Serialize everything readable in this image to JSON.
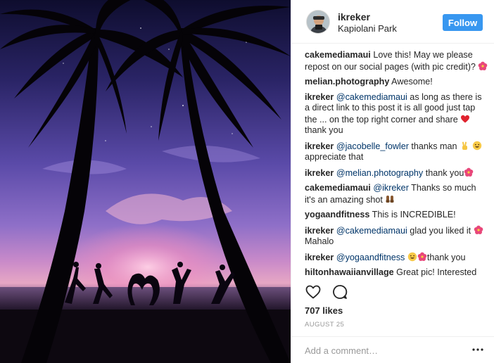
{
  "post": {
    "username": "ikreker",
    "location": "Kapiolani Park",
    "follow_label": "Follow",
    "likes": "707 likes",
    "date": "AUGUST 25",
    "add_comment_placeholder": "Add a comment…"
  },
  "colors": {
    "follow_button": "#3897f0",
    "mention": "#003569",
    "muted": "#999999"
  },
  "icons": {
    "like": "heart-outline-icon",
    "comment": "speech-bubble-icon",
    "more": "ellipsis-icon"
  },
  "comments": [
    {
      "user": "cakemediamaui",
      "parts": [
        {
          "t": "text",
          "v": "Love this! May we please repost on our social pages (with pic credit)? "
        },
        {
          "t": "emoji",
          "v": "hibiscus"
        }
      ]
    },
    {
      "user": "melian.photography",
      "parts": [
        {
          "t": "text",
          "v": "Awesome!"
        }
      ]
    },
    {
      "user": "ikreker",
      "parts": [
        {
          "t": "mention",
          "v": "@cakemediamaui"
        },
        {
          "t": "text",
          "v": " as long as there is a direct link to this post it is all good just tap the ... on the top right corner and share "
        },
        {
          "t": "emoji",
          "v": "heart"
        },
        {
          "t": "text",
          "v": "thank you"
        }
      ]
    },
    {
      "user": "ikreker",
      "parts": [
        {
          "t": "mention",
          "v": "@jacobelle_fowler"
        },
        {
          "t": "text",
          "v": " thanks man "
        },
        {
          "t": "emoji",
          "v": "victory"
        },
        {
          "t": "text",
          "v": " "
        },
        {
          "t": "emoji",
          "v": "smile"
        },
        {
          "t": "text",
          "v": "appreciate that"
        }
      ]
    },
    {
      "user": "ikreker",
      "parts": [
        {
          "t": "mention",
          "v": "@melian.photography"
        },
        {
          "t": "text",
          "v": " thank you"
        },
        {
          "t": "emoji",
          "v": "hibiscus"
        }
      ]
    },
    {
      "user": "cakemediamaui",
      "parts": [
        {
          "t": "mention",
          "v": "@ikreker"
        },
        {
          "t": "text",
          "v": " Thanks so much it's an amazing shot "
        },
        {
          "t": "emoji",
          "v": "praise"
        }
      ]
    },
    {
      "user": "yogaandfitness",
      "parts": [
        {
          "t": "text",
          "v": "This is INCREDIBLE!"
        }
      ]
    },
    {
      "user": "ikreker",
      "parts": [
        {
          "t": "mention",
          "v": "@cakemediamaui"
        },
        {
          "t": "text",
          "v": " glad you liked it "
        },
        {
          "t": "emoji",
          "v": "hibiscus"
        },
        {
          "t": "text",
          "v": "Mahalo"
        }
      ]
    },
    {
      "user": "ikreker",
      "parts": [
        {
          "t": "mention",
          "v": "@yogaandfitness"
        },
        {
          "t": "text",
          "v": " "
        },
        {
          "t": "emoji",
          "v": "smile"
        },
        {
          "t": "emoji",
          "v": "hibiscus"
        },
        {
          "t": "text",
          "v": "thank you"
        }
      ]
    },
    {
      "user": "hiltonhawaiianvillage",
      "parts": [
        {
          "t": "text",
          "v": "Great pic! Interested"
        }
      ]
    }
  ]
}
